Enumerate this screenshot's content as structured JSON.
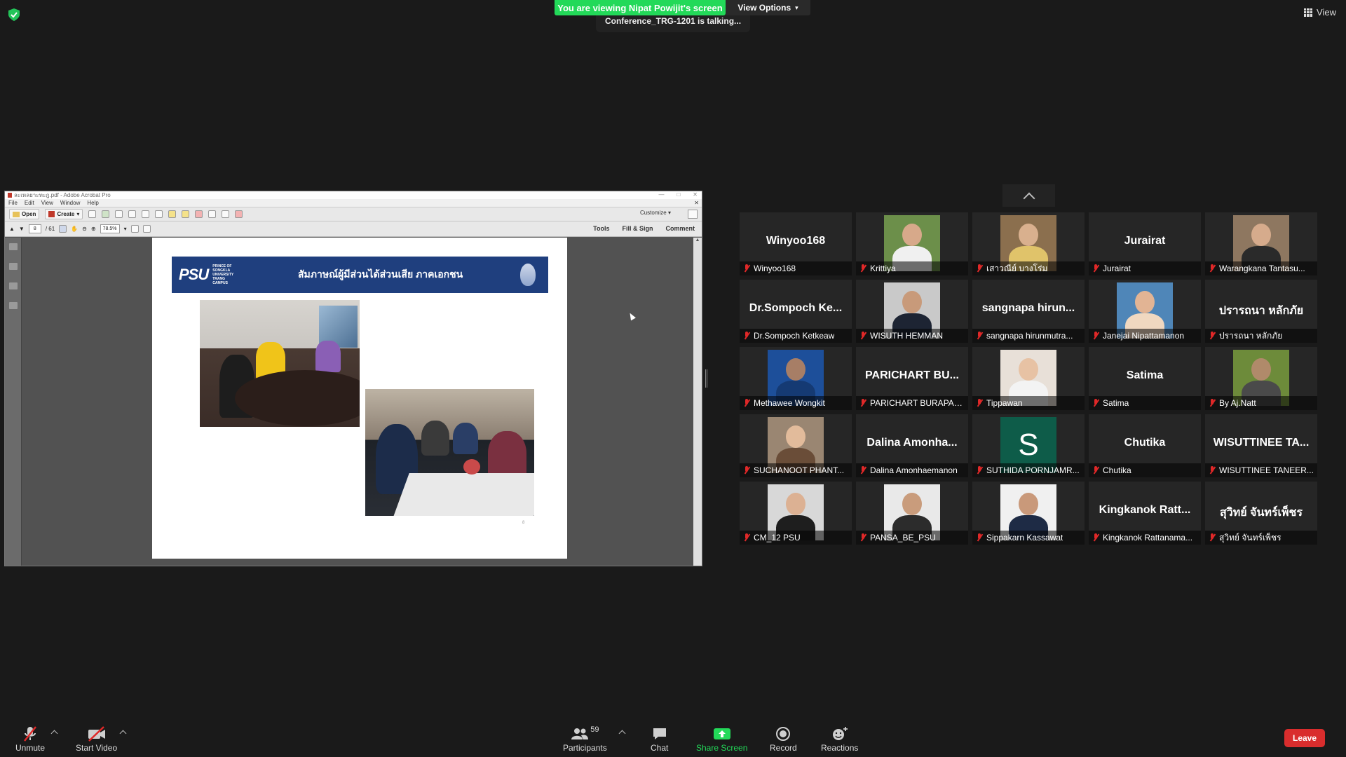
{
  "top": {
    "viewing_banner": "You are viewing Nipat Powijit's screen",
    "view_options": "View Options",
    "talking": "Conference_TRG-1201 is talking...",
    "view_label": "View",
    "security_icon": "shield-check-icon"
  },
  "shared": {
    "window_title": "ละเหลยาะทะฎ.pdf - Adobe Acrobat Pro",
    "menu": [
      "File",
      "Edit",
      "View",
      "Window",
      "Help"
    ],
    "toolbar": {
      "open": "Open",
      "create": "Create",
      "customize": "Customize"
    },
    "page_current": "8",
    "page_total": "/ 61",
    "zoom": "78.5%",
    "right_links": [
      "Tools",
      "Fill & Sign",
      "Comment"
    ],
    "slide": {
      "logo_text": "PSU",
      "logo_sub": "PRINCE OF SONGKLA UNIVERSITY TRANG CAMPUS",
      "title": "สัมภาษณ์ผู้มีส่วนได้ส่วนเสีย ภาคเอกชน",
      "page_number": "8"
    }
  },
  "gallery": {
    "tiles": [
      {
        "name": "Winyoo168",
        "display": "Winyoo168",
        "type": "name"
      },
      {
        "name": "Krittiya",
        "type": "photo",
        "bg": "#6c8f4a",
        "skin": "#d7a98a",
        "shirt": "#f0f0f0"
      },
      {
        "name": "เสาวณีย์ บางโร่ม",
        "type": "photo",
        "bg": "#8b6f4e",
        "skin": "#d9b08e",
        "shirt": "#e0c36a"
      },
      {
        "name": "Jurairat",
        "display": "Jurairat",
        "type": "name"
      },
      {
        "name": "Warangkana Tantasu...",
        "type": "photo",
        "bg": "#8e7760",
        "skin": "#d6ab8c",
        "shirt": "#2a2a2a"
      },
      {
        "name": "Dr.Sompoch Ketkeaw",
        "display": "Dr.Sompoch  Ke...",
        "type": "name"
      },
      {
        "name": "WISUTH HEMMAN",
        "type": "photo",
        "bg": "#c9c9c9",
        "skin": "#c89a7a",
        "shirt": "#1d2433"
      },
      {
        "name": "sangnapa hirunmutra...",
        "display": "sangnapa  hirun...",
        "type": "name"
      },
      {
        "name": "Janejai Nipattamanon",
        "type": "photo",
        "bg": "#4f86b8",
        "skin": "#e2b494",
        "shirt": "#f0d8c0"
      },
      {
        "name": "ปรารถนา หลักภัย",
        "display": "ปรารถนา  หลักภัย",
        "type": "name"
      },
      {
        "name": "Methawee Wongkit",
        "type": "photo",
        "bg": "#1d4f9a",
        "skin": "#a77e66",
        "shirt": "#153a73"
      },
      {
        "name": "PARICHART BURAPASI...",
        "display": "PARICHART  BU...",
        "type": "name"
      },
      {
        "name": "Tippawan",
        "type": "photo",
        "bg": "#e8e0d8",
        "skin": "#e7c2a4",
        "shirt": "#f3f3f3"
      },
      {
        "name": "Satima",
        "display": "Satima",
        "type": "name"
      },
      {
        "name": "By Aj.Natt",
        "type": "photo",
        "bg": "#6d8b3a",
        "skin": "#b08a6a",
        "shirt": "#4a4a4a"
      },
      {
        "name": "SUCHANOOT PHANT...",
        "type": "photo",
        "bg": "#9a8672",
        "skin": "#e2bb9b",
        "shirt": "#6a4d38"
      },
      {
        "name": "Dalina Amonhaemanon",
        "display": "Dalina  Amonha...",
        "type": "name"
      },
      {
        "name": "SUTHIDA PORNJAMR...",
        "type": "letter",
        "letter": "S"
      },
      {
        "name": "Chutika",
        "display": "Chutika",
        "type": "name"
      },
      {
        "name": "WISUTTINEE TANEER...",
        "display": "WISUTTINEE  TA...",
        "type": "name"
      },
      {
        "name": "CM_12 PSU",
        "type": "photo",
        "bg": "#d8d8d8",
        "skin": "#dcb193",
        "shirt": "#1e1e1e"
      },
      {
        "name": "PANSA_BE_PSU",
        "type": "photo",
        "bg": "#e9e9e9",
        "skin": "#c99c7c",
        "shirt": "#2c2c2c"
      },
      {
        "name": "Sippakarn Kassawat",
        "type": "photo",
        "bg": "#f0f0f0",
        "skin": "#c9997a",
        "shirt": "#1e2b45"
      },
      {
        "name": "Kingkanok Rattanama...",
        "display": "Kingkanok  Ratt...",
        "type": "name"
      },
      {
        "name": "สุวิทย์ จันทร์เพ็ชร",
        "display": "สุวิทย์  จันทร์เพ็ชร",
        "type": "name"
      }
    ]
  },
  "toolbar": {
    "unmute": "Unmute",
    "start_video": "Start Video",
    "participants": "Participants",
    "participants_count": "59",
    "chat": "Chat",
    "share_screen": "Share Screen",
    "record": "Record",
    "reactions": "Reactions",
    "leave": "Leave"
  }
}
